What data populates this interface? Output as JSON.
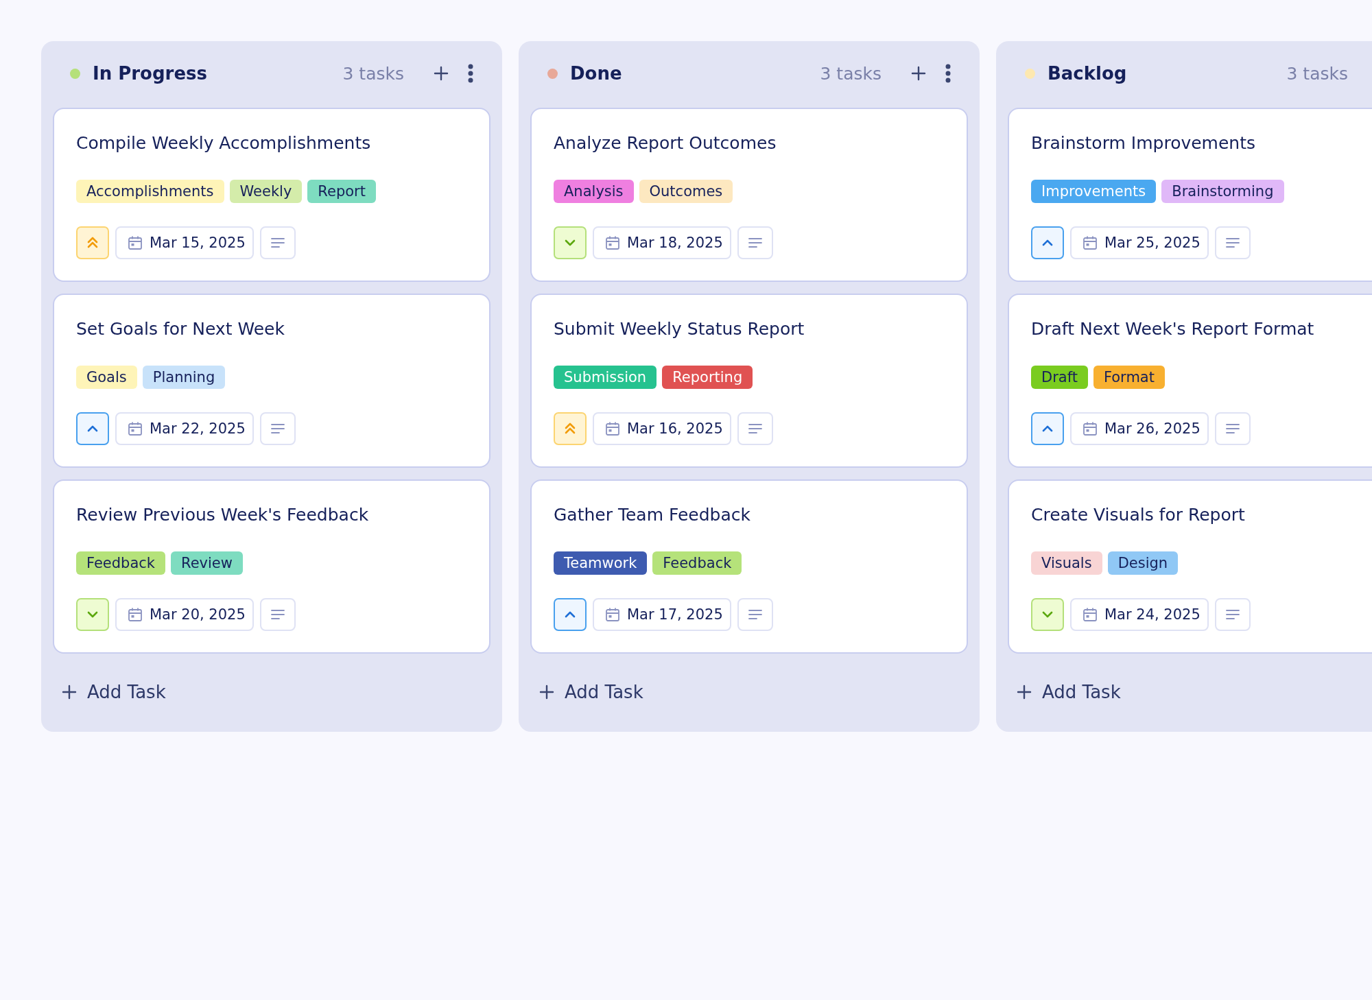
{
  "columns": [
    {
      "title": "In Progress",
      "color": "#b5e07a",
      "count": "3 tasks",
      "show_actions": true,
      "add_label": "Add Task",
      "cards": [
        {
          "title": "Compile Weekly Accomplishments",
          "tags": [
            {
              "label": "Accomplishments",
              "color": "#fef4b8"
            },
            {
              "label": "Weekly",
              "color": "#d4ecaa"
            },
            {
              "label": "Report",
              "color": "#7edcc0"
            }
          ],
          "priority": {
            "kind": "urgent"
          },
          "date": "Mar 15, 2025"
        },
        {
          "title": "Set Goals for Next Week",
          "tags": [
            {
              "label": "Goals",
              "color": "#fef4b8"
            },
            {
              "label": "Planning",
              "color": "#c8e2fa"
            }
          ],
          "priority": {
            "kind": "high"
          },
          "date": "Mar 22, 2025"
        },
        {
          "title": "Review Previous Week's Feedback",
          "tags": [
            {
              "label": "Feedback",
              "color": "#b5e27a"
            },
            {
              "label": "Review",
              "color": "#7edcc0"
            }
          ],
          "priority": {
            "kind": "low"
          },
          "date": "Mar 20, 2025"
        }
      ]
    },
    {
      "title": "Done",
      "color": "#e8a898",
      "count": "3 tasks",
      "show_actions": true,
      "add_label": "Add Task",
      "cards": [
        {
          "title": "Analyze Report Outcomes",
          "tags": [
            {
              "label": "Analysis",
              "color": "#ef7fe0"
            },
            {
              "label": "Outcomes",
              "color": "#fde8c0"
            }
          ],
          "priority": {
            "kind": "low"
          },
          "date": "Mar 18, 2025"
        },
        {
          "title": "Submit Weekly Status Report",
          "tags": [
            {
              "label": "Submission",
              "color": "#26c28f"
            },
            {
              "label": "Reporting",
              "color": "#e05252"
            }
          ],
          "priority": {
            "kind": "urgent"
          },
          "date": "Mar 16, 2025"
        },
        {
          "title": "Gather Team Feedback",
          "tags": [
            {
              "label": "Teamwork",
              "color": "#3e5bb0"
            },
            {
              "label": "Feedback",
              "color": "#b5e27a"
            }
          ],
          "priority": {
            "kind": "high"
          },
          "date": "Mar 17, 2025"
        }
      ]
    },
    {
      "title": "Backlog",
      "color": "#fde8b0",
      "count": "3 tasks",
      "show_actions": false,
      "add_label": "Add Task",
      "cards": [
        {
          "title": "Brainstorm Improvements",
          "tags": [
            {
              "label": "Improvements",
              "color": "#4aa8f0"
            },
            {
              "label": "Brainstorming",
              "color": "#e0b8f8"
            }
          ],
          "priority": {
            "kind": "high"
          },
          "date": "Mar 25, 2025"
        },
        {
          "title": "Draft Next Week's Report Format",
          "tags": [
            {
              "label": "Draft",
              "color": "#7acc20"
            },
            {
              "label": "Format",
              "color": "#f8b030"
            }
          ],
          "priority": {
            "kind": "high"
          },
          "date": "Mar 26, 2025"
        },
        {
          "title": "Create Visuals for Report",
          "tags": [
            {
              "label": "Visuals",
              "color": "#f8d4d4"
            },
            {
              "label": "Design",
              "color": "#90c8f5"
            }
          ],
          "priority": {
            "kind": "low"
          },
          "date": "Mar 24, 2025"
        }
      ]
    }
  ]
}
